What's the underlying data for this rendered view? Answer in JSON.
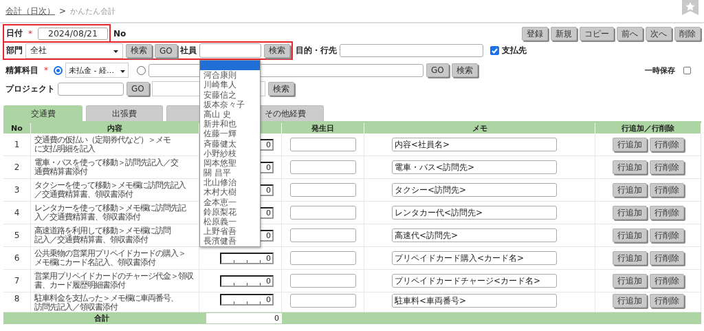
{
  "breadcrumb": {
    "link": "会計（日次）",
    "separator": ">",
    "current": "かんたん会計"
  },
  "toolbar_buttons": [
    "登録",
    "新規",
    "コピー",
    "前へ",
    "次へ",
    "削除"
  ],
  "date_row": {
    "highlighted": true,
    "label": "日付",
    "required_mark": "*",
    "date": "2024/08/21",
    "no_label": "No"
  },
  "filter_row": {
    "highlighted": true,
    "department_label": "部門",
    "department": "全社",
    "department_buttons": [
      "検索",
      "GO"
    ],
    "employee_label": "社員",
    "employee_button": "検索",
    "purpose_label": "目的・行先",
    "payee_checked": true,
    "payee_label": "支払先"
  },
  "account_row": {
    "label": "精算科目",
    "required_mark": "*",
    "choices": [
      {
        "kind": "select",
        "selected": true,
        "value": "未払金 - 経…"
      },
      {
        "kind": "input",
        "selected": false
      }
    ],
    "buttons": [
      "GO",
      "検索"
    ],
    "temp_save_label": "一時保存",
    "temp_save_checked": false
  },
  "project_row": {
    "label": "プロジェクト",
    "go_button": "GO",
    "search_button": "検索"
  },
  "tabs": [
    {
      "label": "交通費",
      "selected": true
    },
    {
      "label": "出張費",
      "selected": false
    },
    {
      "selected": false
    },
    {
      "label": "その他経費",
      "selected": false
    }
  ],
  "table": {
    "columns": [
      {
        "kind": "no",
        "label": "No"
      },
      {
        "kind": "content",
        "label": "内容"
      },
      {
        "kind": "amount"
      },
      {
        "kind": "date",
        "label": "発生日"
      },
      {
        "kind": "memo",
        "label": "メモ"
      },
      {
        "kind": "actions",
        "label": "行追加／行削除"
      }
    ],
    "rows": [
      {
        "no": "1",
        "content": [
          "交通費の仮払い（定期券代など）＞メモ",
          "に支払明細を記入"
        ],
        "amount": "0",
        "memo": "内容<社員名>",
        "actions": [
          "行追加",
          "行削除"
        ]
      },
      {
        "no": "2",
        "content": [
          "電車・バスを使って移動＞訪問先記入／交",
          "通費精算書添付"
        ],
        "amount": "0",
        "memo": "電車・バス<訪問先>",
        "actions": [
          "行追加",
          "行削除"
        ]
      },
      {
        "no": "3",
        "content": [
          "タクシーを使って移動＞メモ欄に訪問先記入",
          "／交通費精算書、領収書添付"
        ],
        "amount": "0",
        "memo": "タクシー<訪問先>",
        "actions": [
          "行追加",
          "行削除"
        ]
      },
      {
        "no": "4",
        "content": [
          "レンタカーを使って移動＞メモ欄に訪問先記",
          "入／交通費精算書、領収書添付"
        ],
        "amount": "0",
        "memo": "レンタカー代<訪問先>",
        "actions": [
          "行追加",
          "行削除"
        ]
      },
      {
        "no": "5",
        "content": [
          "高速道路を利用して移動＞メモ欄に訪問",
          "記入／交通費精算書、領収書添付"
        ],
        "amount": "0",
        "memo": "高速代<訪問先>",
        "actions": [
          "行追加",
          "行削除"
        ]
      },
      {
        "no": "6",
        "content": [
          "公共乗物の営業用プリペイドカードの購入＞",
          "メモ欄にカード名記入、領収書添付"
        ],
        "amount": "0",
        "memo": "プリペイドカード購入<カード名>",
        "actions": [
          "行追加",
          "行削除"
        ]
      },
      {
        "no": "7",
        "content": [
          "営業用プリペイドカードのチャージ代金＞領収",
          "書、カード履歴明細書添付"
        ],
        "amount": "0",
        "memo": "プリペイドカードチャージ<カード名>",
        "actions": [
          "行追加",
          "行削除"
        ]
      },
      {
        "no": "8",
        "content": [
          "駐車料金を支払った＞メモ欄に車両番号、",
          "訪問先記入／領収書添付"
        ],
        "amount": "0",
        "memo": "駐車料<車両番号>",
        "actions": [
          "行追加",
          "行削除"
        ]
      }
    ],
    "total": {
      "label": "合計",
      "amount": "0"
    }
  },
  "employee_dropdown": {
    "items": [
      {
        "selected": true
      },
      {
        "label": "河合康則",
        "selected": false
      },
      {
        "label": "川崎隼人",
        "selected": false
      },
      {
        "label": "安藤信之",
        "selected": false
      },
      {
        "label": "坂本奈々子",
        "selected": false
      },
      {
        "label": "高山 史",
        "selected": false
      },
      {
        "label": "新井和也",
        "selected": false
      },
      {
        "label": "佐藤一輝",
        "selected": false
      },
      {
        "label": "斉藤健太",
        "selected": false
      },
      {
        "label": "小野紗枝",
        "selected": false
      },
      {
        "label": "岡本悠聖",
        "selected": false
      },
      {
        "label": "關 昌平",
        "selected": false
      },
      {
        "label": "北山修治",
        "selected": false
      },
      {
        "label": "木村大樹",
        "selected": false
      },
      {
        "label": "金本恵一",
        "selected": false
      },
      {
        "label": "鈴原梨花",
        "selected": false
      },
      {
        "label": "松原義一",
        "selected": false
      },
      {
        "label": "上野省吾",
        "selected": false
      },
      {
        "label": "長濱健吾",
        "selected": false
      }
    ]
  }
}
